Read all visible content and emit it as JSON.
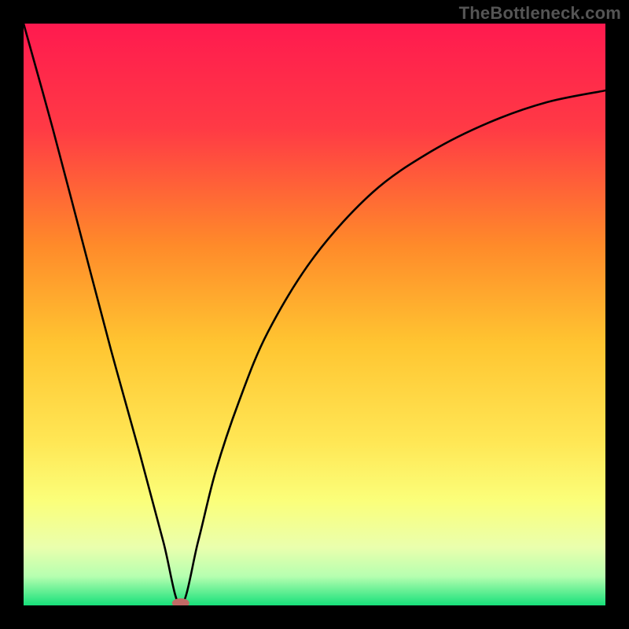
{
  "watermark": {
    "text": "TheBottleneck.com"
  },
  "chart_data": {
    "type": "line",
    "title": "",
    "xlabel": "",
    "ylabel": "",
    "xlim": [
      0,
      100
    ],
    "ylim": [
      0,
      100
    ],
    "optimum_x": 27,
    "series": [
      {
        "name": "bottleneck-curve",
        "x": [
          0,
          5,
          10,
          15,
          20,
          24,
          27,
          30,
          33,
          37,
          42,
          50,
          60,
          70,
          80,
          90,
          100
        ],
        "values": [
          100,
          82,
          63,
          44,
          26,
          11,
          0,
          11,
          23,
          35,
          47,
          60,
          71,
          78,
          83,
          86.5,
          88.5
        ]
      }
    ],
    "marker": {
      "x": 27,
      "y": 0,
      "color": "#c16a66"
    },
    "gradient": {
      "top": "#ff1a4f",
      "mid_upper": "#ff7a2a",
      "mid": "#ffd23a",
      "mid_lower": "#fff56a",
      "band": "#f9ffa8",
      "bottom": "#1ee07a"
    },
    "grid": false,
    "legend": null
  }
}
